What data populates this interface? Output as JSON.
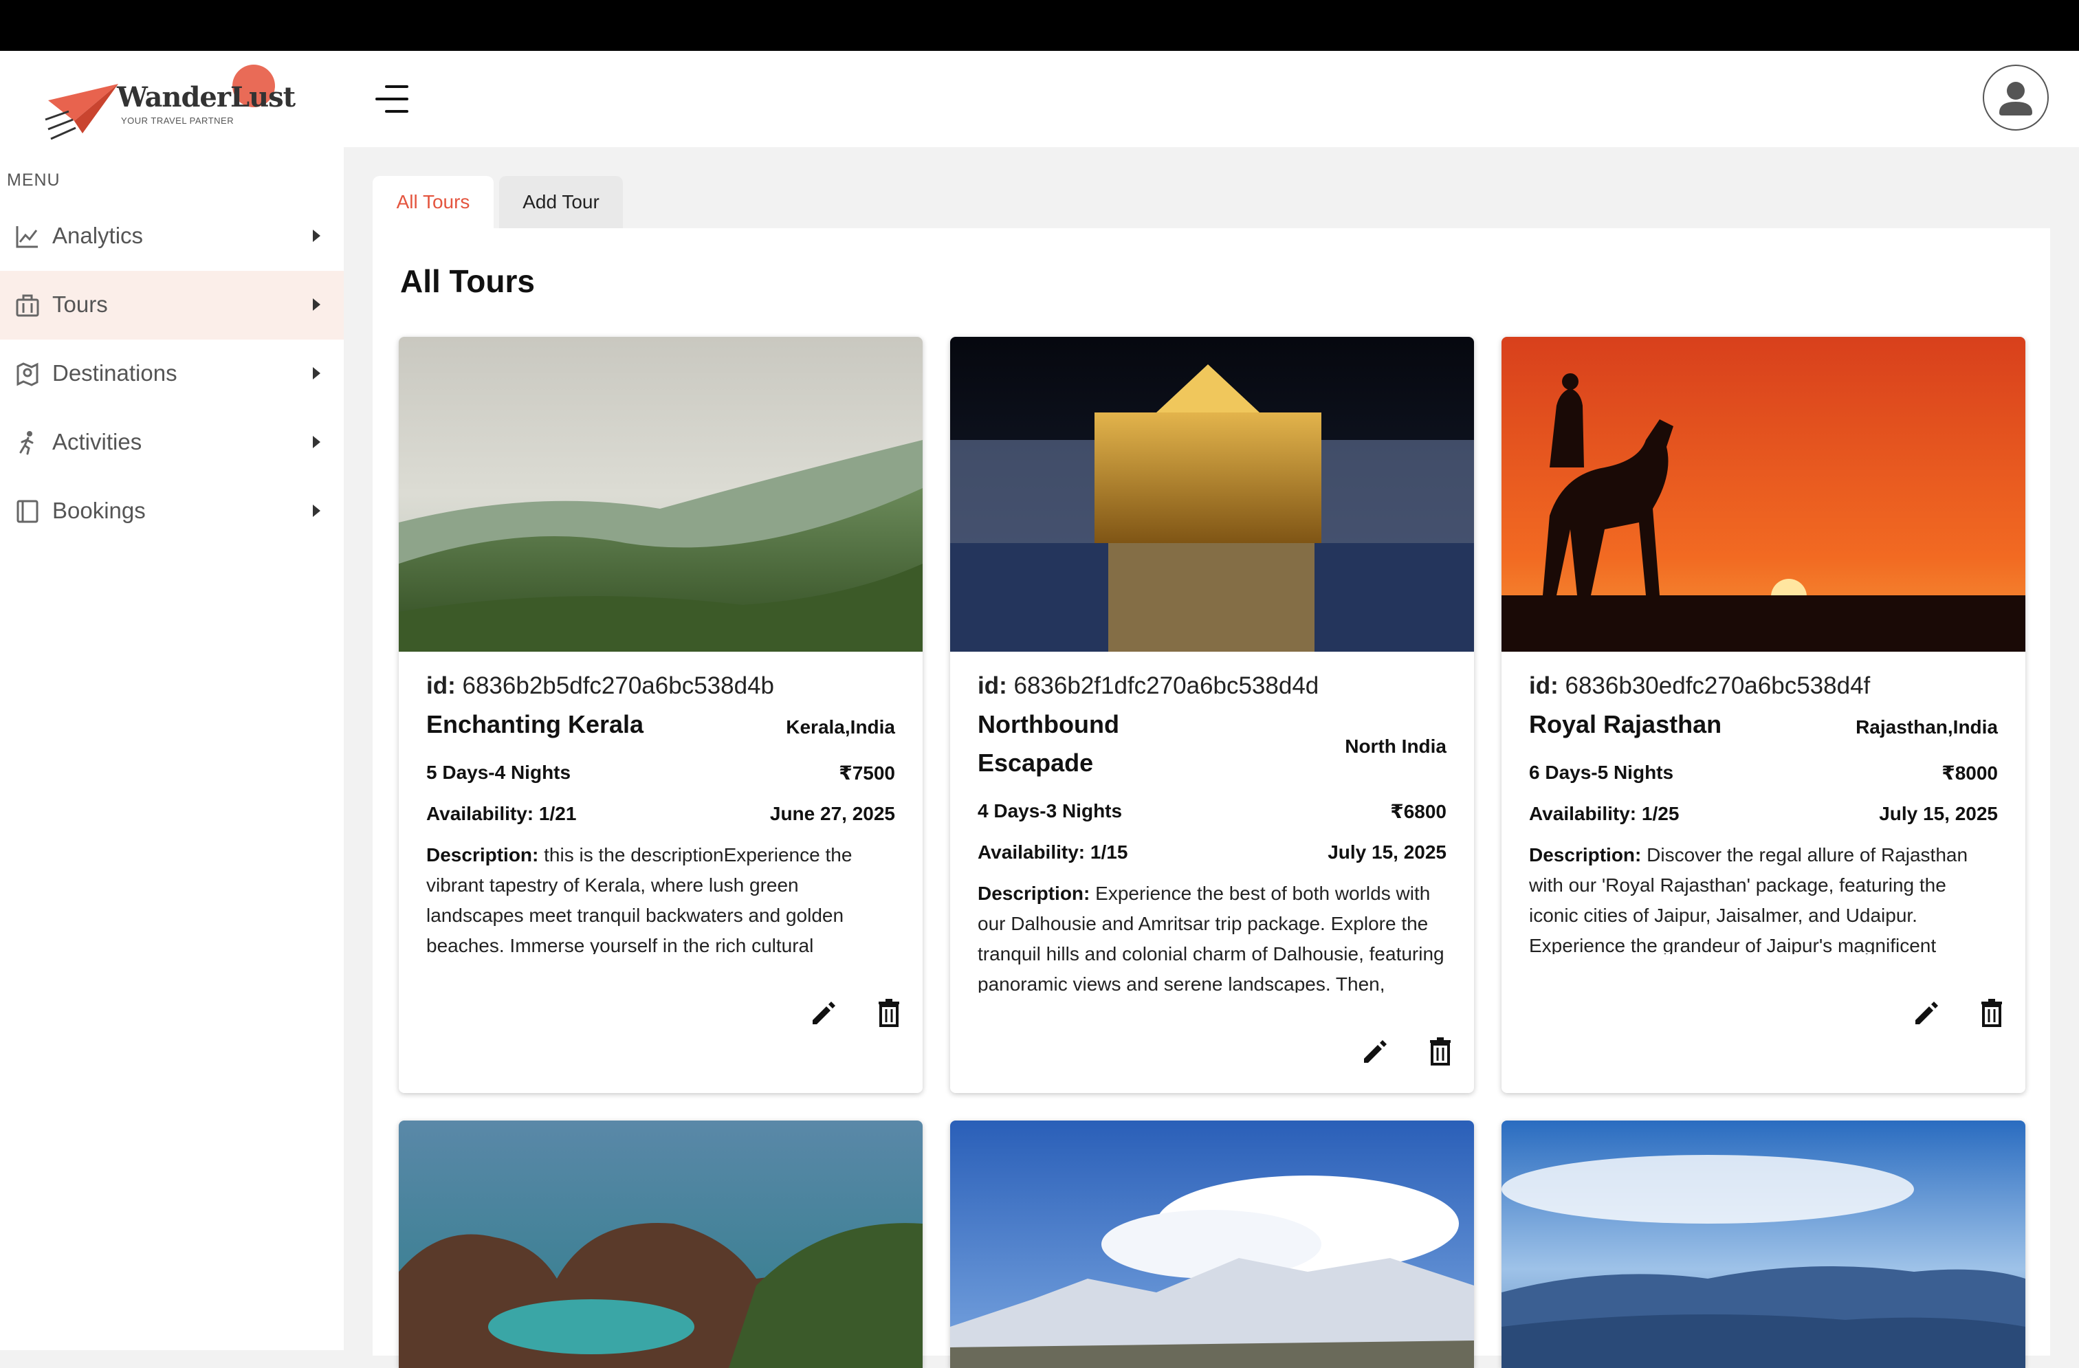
{
  "brand": {
    "name": "WanderLust",
    "tagline": "YOUR TRAVEL PARTNER",
    "accent": "#e8634e"
  },
  "sidebar": {
    "menu_label": "MENU",
    "items": [
      {
        "label": "Analytics",
        "icon": "chart-line-icon"
      },
      {
        "label": "Tours",
        "icon": "suitcase-icon",
        "active": true
      },
      {
        "label": "Destinations",
        "icon": "map-pin-icon"
      },
      {
        "label": "Activities",
        "icon": "person-running-icon"
      },
      {
        "label": "Bookings",
        "icon": "book-icon"
      }
    ]
  },
  "tabs": [
    {
      "label": "All Tours",
      "active": true
    },
    {
      "label": "Add Tour"
    }
  ],
  "main": {
    "title": "All Tours",
    "id_prefix": "id:",
    "availability_prefix": "Availability:",
    "description_prefix": "Description:",
    "tours": [
      {
        "id": "6836b2b5dfc270a6bc538d4b",
        "title": "Enchanting Kerala",
        "location": "Kerala,India",
        "duration": "5 Days-4 Nights",
        "price": "₹7500",
        "availability": "1/21",
        "date": "June 27, 2025",
        "description": "this is the descriptionExperience the vibrant tapestry of Kerala, where lush green landscapes meet tranquil backwaters and golden beaches. Immerse yourself in the rich cultural heritage, savour the exquisite local cuisine and thrill"
      },
      {
        "id": "6836b2f1dfc270a6bc538d4d",
        "title": "Northbound Escapade",
        "location": "North India",
        "duration": "4 Days-3 Nights",
        "price": "₹6800",
        "availability": "1/15",
        "date": "July 15, 2025",
        "description": "Experience the best of both worlds with our Dalhousie and Amritsar trip package. Explore the tranquil hills and colonial charm of Dalhousie, featuring panoramic views and serene landscapes. Then, immerse yourself in the vibrant"
      },
      {
        "id": "6836b30edfc270a6bc538d4f",
        "title": "Royal Rajasthan",
        "location": "Rajasthan,India",
        "duration": "6 Days-5 Nights",
        "price": "₹8000",
        "availability": "1/25",
        "date": "July 15, 2025",
        "description": "Discover the regal allure of Rajasthan with our 'Royal Rajasthan' package, featuring the iconic cities of Jaipur, Jaisalmer, and Udaipur. Experience the grandeur of Jaipur's magnificent palaces and forts, immerse yourself in the golden"
      }
    ]
  }
}
